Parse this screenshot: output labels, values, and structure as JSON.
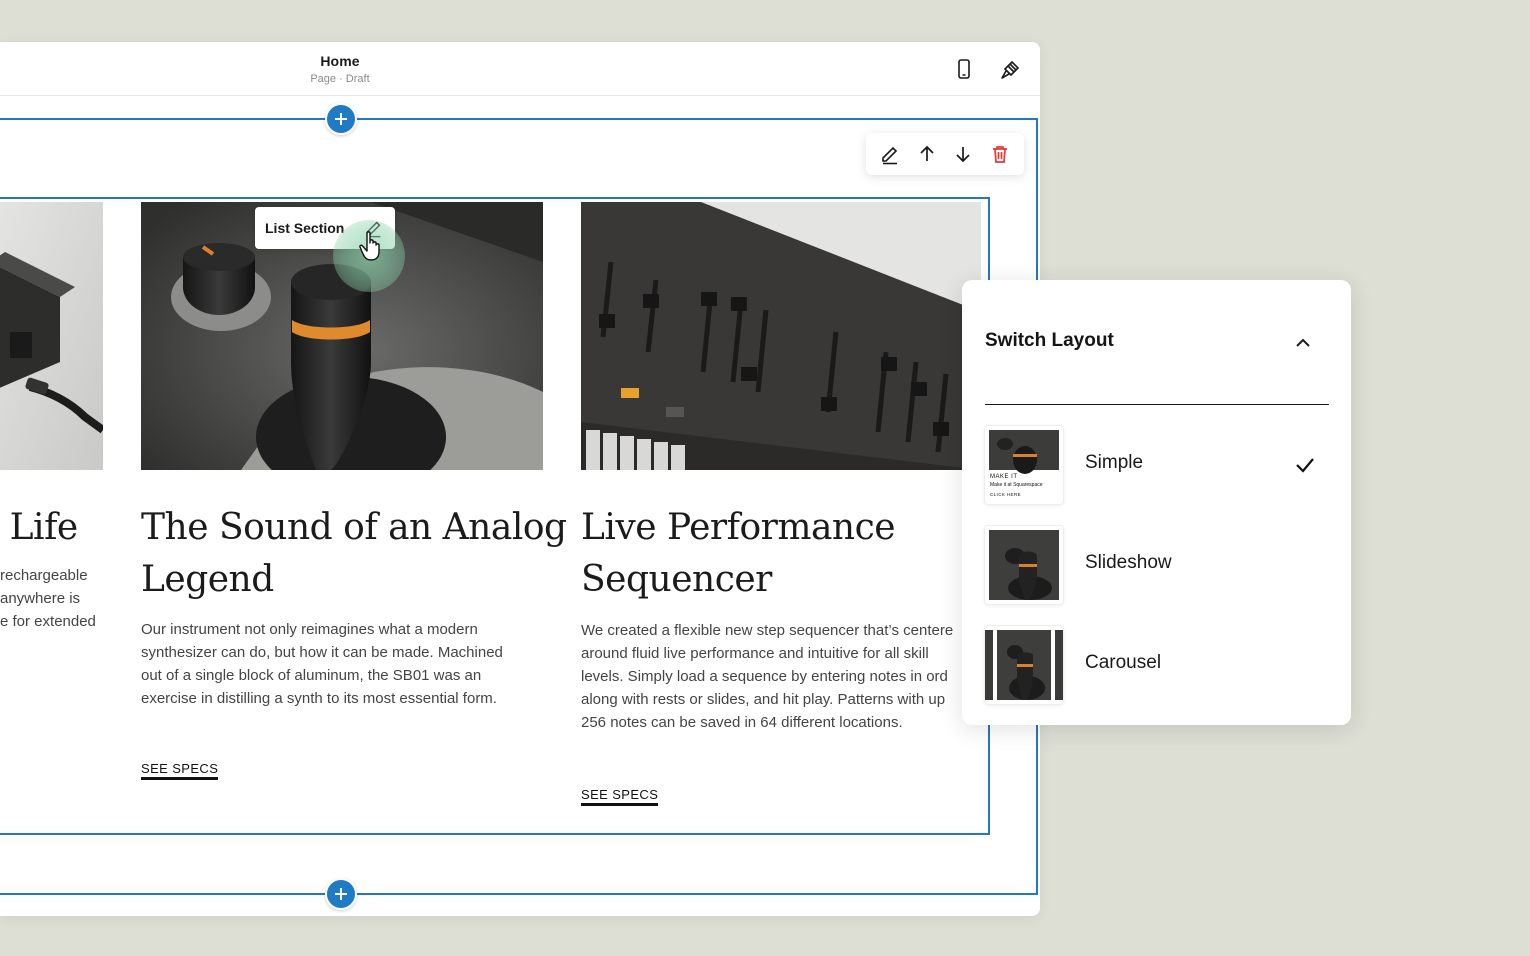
{
  "topbar": {
    "title": "Home",
    "subtitle": "Page · Draft",
    "mobile_icon": "mobile-phone-icon",
    "style_icon": "paintbrush-icon"
  },
  "section_toolbar": {
    "edit_icon": "pencil-icon",
    "up_icon": "arrow-up-icon",
    "down_icon": "arrow-down-icon",
    "delete_icon": "trash-icon",
    "delete_color": "#e53935"
  },
  "list_tag": {
    "label": "List Section",
    "icon": "pencil-icon"
  },
  "cards": [
    {
      "title": "r Life",
      "body_lines": [
        "rechargeable",
        "anywhere is",
        "e for extended"
      ]
    },
    {
      "title_lines": [
        "The Sound of an Analog",
        "Legend"
      ],
      "body_lines": [
        "Our instrument not only reimagines what a modern",
        "synthesizer can do, but how it can be made. Machined",
        "out of a single block of aluminum, the SB01 was an",
        "exercise in distilling a synth to its most essential form."
      ],
      "cta": "SEE SPECS"
    },
    {
      "title_lines": [
        "Live Performance",
        "Sequencer"
      ],
      "body_lines": [
        "We created a flexible new step sequencer that’s centere",
        "around fluid live performance and intuitive for all skill",
        "levels. Simply load a sequence by entering notes in ord",
        "along with rests or slides, and hit play. Patterns with up",
        "256 notes can be saved in 64 different locations."
      ],
      "cta": "SEE SPECS"
    }
  ],
  "layout_panel": {
    "title": "Switch Layout",
    "collapse_icon": "chevron-up-icon",
    "options": [
      {
        "label": "Simple",
        "selected": true,
        "thumb_lines": [
          "MAKE IT",
          "Make it at Squarespace",
          "CLICK HERE"
        ]
      },
      {
        "label": "Slideshow",
        "selected": false
      },
      {
        "label": "Carousel",
        "selected": false
      }
    ]
  },
  "colors": {
    "accent": "#2279c2",
    "background": "#dddfd5",
    "ripple": "#8cd2aa"
  }
}
